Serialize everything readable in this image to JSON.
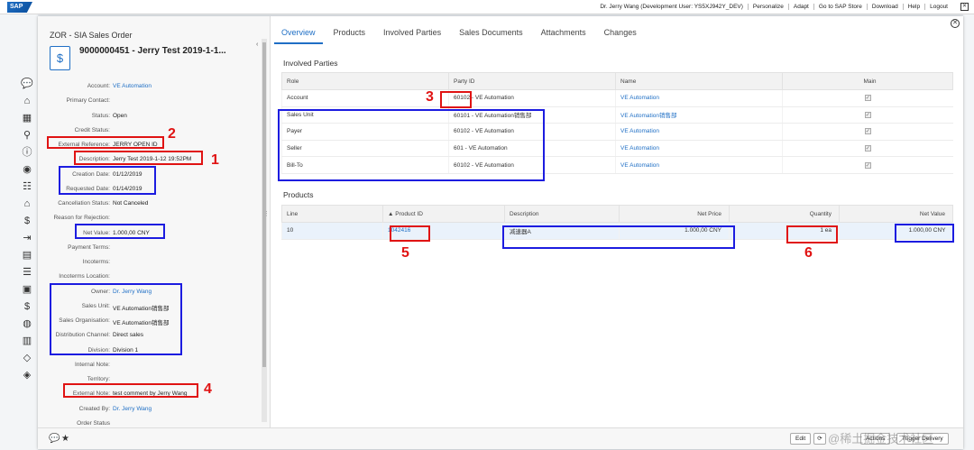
{
  "shell": {
    "logo": "SAP",
    "nav": [
      "Dr. Jerry Wang (Development User: YS5XJ942Y_DEV)",
      "Personalize",
      "Adapt",
      "Go to SAP Store",
      "Download",
      "Help",
      "Logout"
    ]
  },
  "header": {
    "type": "ZOR - SIA Sales Order",
    "title": "9000000451 - Jerry Test 2019-1-1...",
    "fields": [
      {
        "label": "Account:",
        "value": "VE Automation",
        "link": true
      },
      {
        "label": "Primary Contact:",
        "value": "",
        "link": false
      },
      {
        "label": "Status:",
        "value": "Open",
        "link": false
      },
      {
        "label": "Credit Status:",
        "value": "",
        "link": false
      },
      {
        "label": "External Reference:",
        "value": "JERRY OPEN ID",
        "link": false
      },
      {
        "label": "Description:",
        "value": "Jerry Test 2019-1-12 19:52PM",
        "link": false
      },
      {
        "label": "Creation Date:",
        "value": "01/12/2019",
        "link": false
      },
      {
        "label": "Requested Date:",
        "value": "01/14/2019",
        "link": false
      },
      {
        "label": "Cancellation Status:",
        "value": "Not Canceled",
        "link": false
      },
      {
        "label": "Reason for Rejection:",
        "value": "",
        "link": false
      },
      {
        "label": "Net Value:",
        "value": "1.000,00 CNY",
        "link": false
      },
      {
        "label": "Payment Terms:",
        "value": "",
        "link": false
      },
      {
        "label": "Incoterms:",
        "value": "",
        "link": false
      },
      {
        "label": "Incoterms Location:",
        "value": "",
        "link": false
      },
      {
        "label": "Owner:",
        "value": "Dr. Jerry Wang",
        "link": true
      },
      {
        "label": "Sales Unit:",
        "value": "VE Automation销售部",
        "link": false
      },
      {
        "label": "Sales Organisation:",
        "value": "VE Automation销售部",
        "link": false
      },
      {
        "label": "Distribution Channel:",
        "value": "Direct sales",
        "link": false
      },
      {
        "label": "Division:",
        "value": "Division 1",
        "link": false
      },
      {
        "label": "Internal Note:",
        "value": "",
        "link": false
      },
      {
        "label": "Territory:",
        "value": "",
        "link": false
      },
      {
        "label": "External Note:",
        "value": "test comment by Jerry Wang",
        "link": false
      },
      {
        "label": "Created By:",
        "value": "Dr. Jerry Wang",
        "link": true
      },
      {
        "label": "Order Status",
        "value": "",
        "link": false
      }
    ]
  },
  "tabs": [
    "Overview",
    "Products",
    "Involved Parties",
    "Sales Documents",
    "Attachments",
    "Changes"
  ],
  "involved": {
    "title": "Involved Parties",
    "columns": [
      "Role",
      "Party ID",
      "Name",
      "Main"
    ],
    "rows": [
      {
        "role": "Account",
        "party_id": "60102",
        "party_name": " - VE Automation",
        "name": "VE Automation"
      },
      {
        "role": "Sales Unit",
        "party_id": "60101",
        "party_name": " - VE Automation销售部",
        "name": "VE Automation销售部"
      },
      {
        "role": "Payer",
        "party_id": "60102",
        "party_name": " - VE Automation",
        "name": "VE Automation"
      },
      {
        "role": "Seller",
        "party_id": "601",
        "party_name": " - VE Automation",
        "name": "VE Automation"
      },
      {
        "role": "Bill-To",
        "party_id": "60102",
        "party_name": " - VE Automation",
        "name": "VE Automation"
      }
    ]
  },
  "products": {
    "title": "Products",
    "columns": [
      "Line",
      "Product ID",
      "Description",
      "Net Price",
      "Quantity",
      "Net Value"
    ],
    "rows": [
      {
        "line": "10",
        "product_id": "1042416",
        "description": "减速器A",
        "net_price": "1.000,00  CNY",
        "quantity": "1  ea",
        "net_value": "1.000,00  CNY"
      }
    ]
  },
  "footer": {
    "buttons": [
      "Edit",
      "Actions",
      "Trigger Delivery"
    ]
  },
  "annotations": [
    "1",
    "2",
    "3",
    "4",
    "5",
    "6"
  ],
  "watermark": "@稀土掘金技术社区"
}
